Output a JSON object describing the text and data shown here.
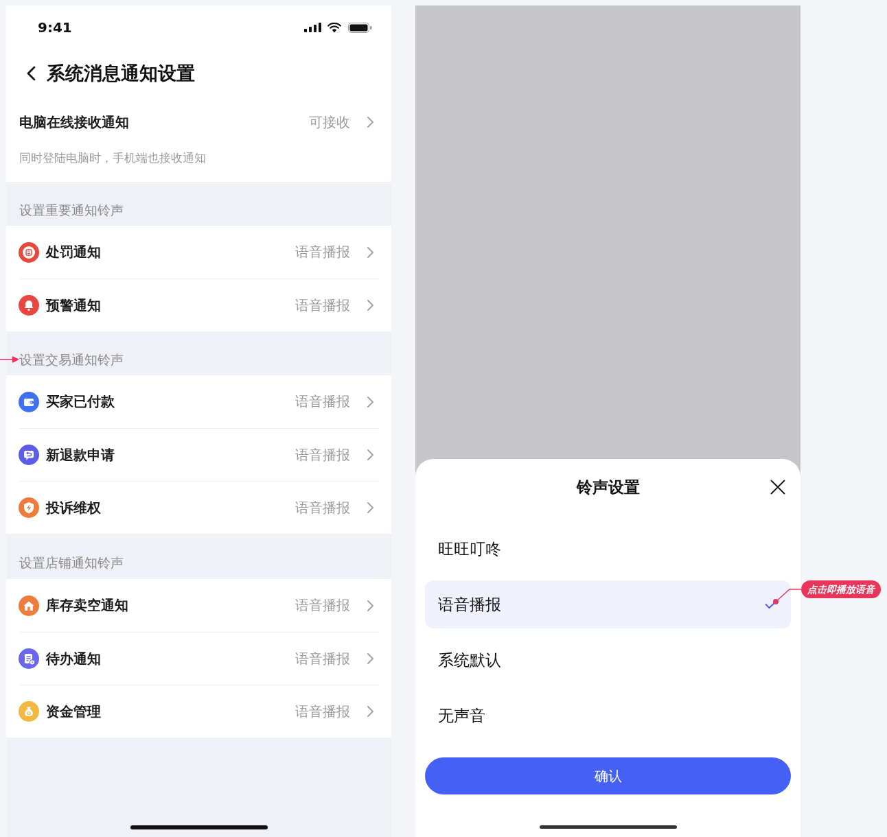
{
  "settings_screen": {
    "status_bar": {
      "time": "9:41"
    },
    "title": "系统消息通知设置",
    "desktop_notification": {
      "label": "电脑在线接收通知",
      "value": "可接收",
      "description": "同时登陆电脑时，手机端也接收通知"
    },
    "sections": [
      {
        "heading": "设置重要通知铃声",
        "arrow_marker": false,
        "items": [
          {
            "kind": "penalty",
            "color": "#e9483f",
            "label": "处罚通知",
            "value": "语音播报"
          },
          {
            "kind": "alert",
            "color": "#e8463e",
            "label": "预警通知",
            "value": "语音播报"
          }
        ]
      },
      {
        "heading": "设置交易通知铃声",
        "arrow_marker": true,
        "items": [
          {
            "kind": "payment",
            "color": "#3f6ff2",
            "label": "买家已付款",
            "value": "语音播报"
          },
          {
            "kind": "refund",
            "color": "#5d5ce8",
            "label": "新退款申请",
            "value": "语音播报"
          },
          {
            "kind": "complaint",
            "color": "#ee7b3c",
            "label": "投诉维权",
            "value": "语音播报"
          }
        ]
      },
      {
        "heading": "设置店铺通知铃声",
        "arrow_marker": false,
        "items": [
          {
            "kind": "stock",
            "color": "#ee7c3d",
            "label": "库存卖空通知",
            "value": "语音播报"
          },
          {
            "kind": "todo",
            "color": "#6a66f0",
            "label": "待办通知",
            "value": "语音播报"
          },
          {
            "kind": "funds",
            "color": "#f3b840",
            "label": "资金管理",
            "value": "语音播报"
          }
        ]
      }
    ]
  },
  "ringtone_sheet": {
    "title": "铃声设置",
    "options": [
      {
        "label": "旺旺叮咚",
        "selected": false
      },
      {
        "label": "语音播报",
        "selected": true,
        "note": "点击即播放语音"
      },
      {
        "label": "系统默认",
        "selected": false
      },
      {
        "label": "无声音",
        "selected": false
      }
    ],
    "confirm_button": "确认"
  }
}
